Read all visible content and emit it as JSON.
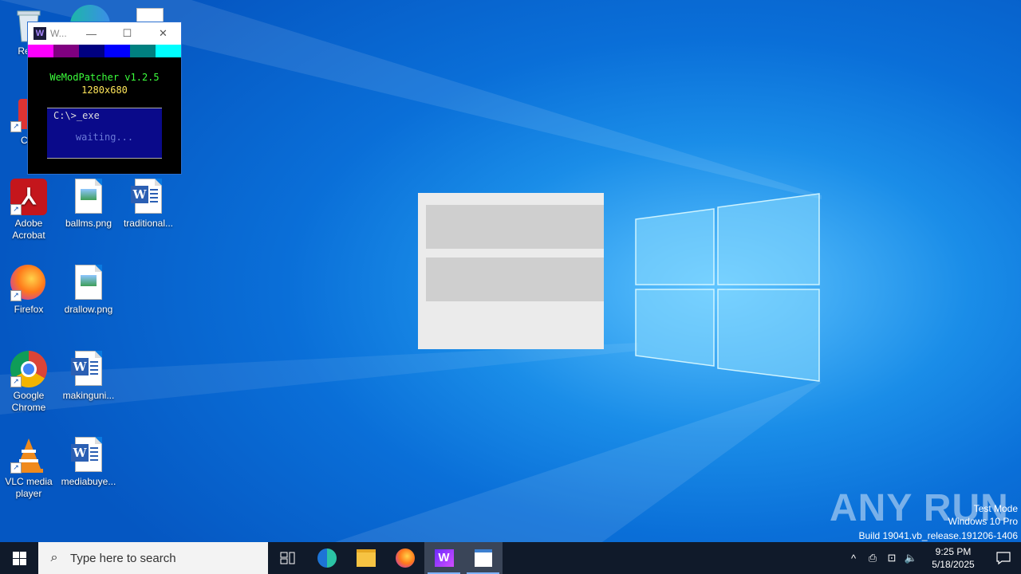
{
  "desktop": {
    "icons": [
      {
        "label": "Recy"
      },
      {
        "label": "CCl"
      },
      {
        "label": "Adobe Acrobat"
      },
      {
        "label": "ballms.png"
      },
      {
        "label": "traditional..."
      },
      {
        "label": "Firefox"
      },
      {
        "label": "drallow.png"
      },
      {
        "label": "Google Chrome"
      },
      {
        "label": "makinguni..."
      },
      {
        "label": "VLC media player"
      },
      {
        "label": "mediabuye..."
      }
    ]
  },
  "patcher": {
    "window_title": "W...",
    "app_title": "WeModPatcher v1.2.5",
    "resolution": "1280x680",
    "prompt": "C:\\>_exe",
    "status": "waiting...",
    "colors": [
      "#ff00ff",
      "#800080",
      "#000080",
      "#0000ff",
      "#008080",
      "#00ffff"
    ]
  },
  "watermark": {
    "brand": "ANY RUN",
    "mode": "Test Mode",
    "os": "Windows 10 Pro",
    "build": "Build 19041.vb_release.191206-1406"
  },
  "taskbar": {
    "search_placeholder": "Type here to search",
    "time": "9:25 PM",
    "date": "5/18/2025"
  }
}
